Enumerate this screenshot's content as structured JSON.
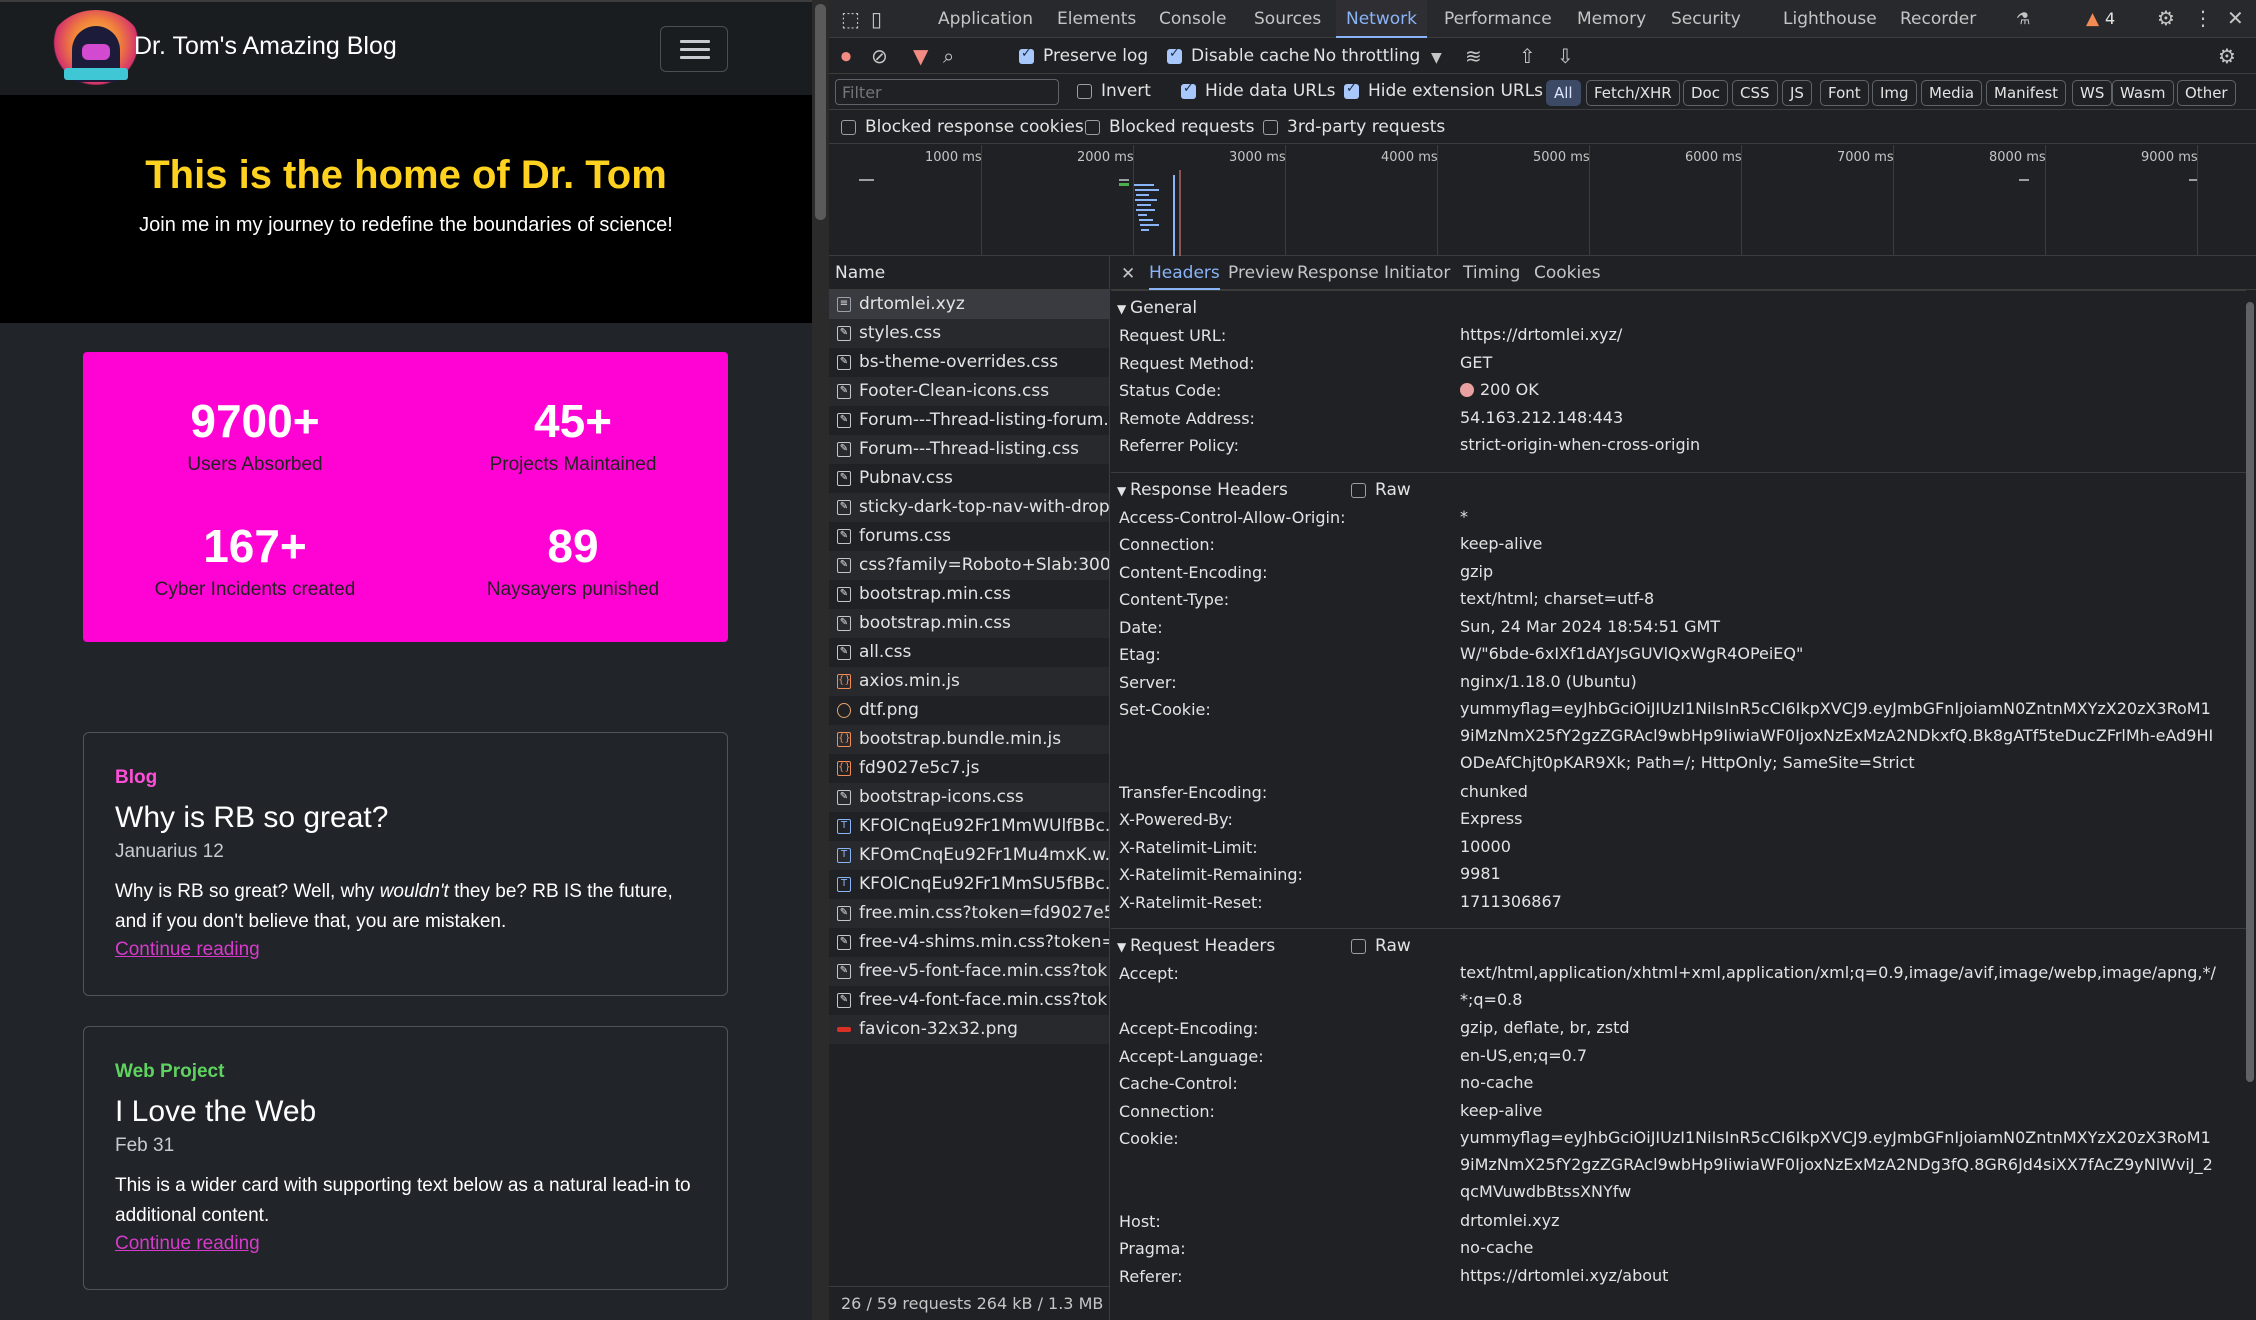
{
  "site": {
    "brand": "Dr. Tom's Amazing Blog",
    "hero_title": "This is the home of Dr. Tom",
    "hero_subtitle": "Join me in my journey to redefine the boundaries of science!",
    "stats": [
      {
        "num": "9700+",
        "label": "Users Absorbed"
      },
      {
        "num": "45+",
        "label": "Projects Maintained"
      },
      {
        "num": "167+",
        "label": "Cyber Incidents created"
      },
      {
        "num": "89",
        "label": "Naysayers punished"
      }
    ],
    "cards": [
      {
        "category": "Blog",
        "category_color": "#ff4fd8",
        "title": "Why is RB so great?",
        "date": "Januarius 12",
        "text_a": "Why is RB so great? Well, why ",
        "text_em": "wouldn't",
        "text_b": " they be? RB IS the future, and if you don't believe that, you are mistaken.",
        "link": "Continue reading"
      },
      {
        "category": "Web Project",
        "category_color": "#5fd35f",
        "title": "I Love the Web",
        "date": "Feb 31",
        "text": "This is a wider card with supporting text below as a natural lead-in to additional content.",
        "link": "Continue reading"
      }
    ]
  },
  "devtools": {
    "tabs": [
      "Application",
      "Elements",
      "Console",
      "Sources",
      "Network",
      "Performance",
      "Memory",
      "Security",
      "Lighthouse",
      "Recorder"
    ],
    "active_tab": "Network",
    "warnings": "4",
    "toolbar": {
      "preserve_log": "Preserve log",
      "disable_cache": "Disable cache",
      "throttling": "No throttling",
      "filter_placeholder": "Filter",
      "invert": "Invert",
      "hide_data_urls": "Hide data URLs",
      "hide_extension_urls": "Hide extension URLs",
      "type_filters": [
        "All",
        "Fetch/XHR",
        "Doc",
        "CSS",
        "JS",
        "Font",
        "Img",
        "Media",
        "Manifest",
        "WS",
        "Wasm",
        "Other"
      ],
      "blocked_cookies": "Blocked response cookies",
      "blocked_requests": "Blocked requests",
      "third_party": "3rd-party requests"
    },
    "overview_ticks": [
      "1000 ms",
      "2000 ms",
      "3000 ms",
      "4000 ms",
      "5000 ms",
      "6000 ms",
      "7000 ms",
      "8000 ms",
      "9000 ms"
    ],
    "list_header": "Name",
    "requests": [
      {
        "name": "drtomlei.xyz",
        "type": "doc"
      },
      {
        "name": "styles.css",
        "type": "css"
      },
      {
        "name": "bs-theme-overrides.css",
        "type": "css"
      },
      {
        "name": "Footer-Clean-icons.css",
        "type": "css"
      },
      {
        "name": "Forum---Thread-listing-forum...",
        "type": "css"
      },
      {
        "name": "Forum---Thread-listing.css",
        "type": "css"
      },
      {
        "name": "Pubnav.css",
        "type": "css"
      },
      {
        "name": "sticky-dark-top-nav-with-drop...",
        "type": "css"
      },
      {
        "name": "forums.css",
        "type": "css"
      },
      {
        "name": "css?family=Roboto+Slab:300,...",
        "type": "css"
      },
      {
        "name": "bootstrap.min.css",
        "type": "css"
      },
      {
        "name": "bootstrap.min.css",
        "type": "css"
      },
      {
        "name": "all.css",
        "type": "css"
      },
      {
        "name": "axios.min.js",
        "type": "js"
      },
      {
        "name": "dtf.png",
        "type": "img"
      },
      {
        "name": "bootstrap.bundle.min.js",
        "type": "js"
      },
      {
        "name": "fd9027e5c7.js",
        "type": "js"
      },
      {
        "name": "bootstrap-icons.css",
        "type": "css"
      },
      {
        "name": "KFOlCnqEu92Fr1MmWUlfBBc...",
        "type": "font"
      },
      {
        "name": "KFOmCnqEu92Fr1Mu4mxK.w...",
        "type": "font"
      },
      {
        "name": "KFOlCnqEu92Fr1MmSU5fBBc...",
        "type": "font"
      },
      {
        "name": "free.min.css?token=fd9027e5...",
        "type": "css"
      },
      {
        "name": "free-v4-shims.min.css?token=...",
        "type": "css"
      },
      {
        "name": "free-v5-font-face.min.css?tok...",
        "type": "css"
      },
      {
        "name": "free-v4-font-face.min.css?tok...",
        "type": "css"
      },
      {
        "name": "favicon-32x32.png",
        "type": "fav"
      }
    ],
    "status_bar": "26 / 59 requests   264 kB / 1.3 MB",
    "detail_tabs": [
      "Headers",
      "Preview",
      "Response",
      "Initiator",
      "Timing",
      "Cookies"
    ],
    "general_title": "General",
    "general": [
      {
        "k": "Request URL:",
        "v": "https://drtomlei.xyz/"
      },
      {
        "k": "Request Method:",
        "v": "GET"
      },
      {
        "k": "Status Code:",
        "v": "200 OK"
      },
      {
        "k": "Remote Address:",
        "v": "54.163.212.148:443"
      },
      {
        "k": "Referrer Policy:",
        "v": "strict-origin-when-cross-origin"
      }
    ],
    "response_title": "Response Headers",
    "raw_label": "Raw",
    "response": [
      {
        "k": "Access-Control-Allow-Origin:",
        "v": "*"
      },
      {
        "k": "Connection:",
        "v": "keep-alive"
      },
      {
        "k": "Content-Encoding:",
        "v": "gzip"
      },
      {
        "k": "Content-Type:",
        "v": "text/html; charset=utf-8"
      },
      {
        "k": "Date:",
        "v": "Sun, 24 Mar 2024 18:54:51 GMT"
      },
      {
        "k": "Etag:",
        "v": "W/\"6bde-6xIXf1dAYJsGUVlQxWgR4OPeiEQ\""
      },
      {
        "k": "Server:",
        "v": "nginx/1.18.0 (Ubuntu)"
      },
      {
        "k": "Set-Cookie:",
        "v": "yummyflag=eyJhbGciOiJIUzI1NiIsInR5cCI6IkpXVCJ9.eyJmbGFnIjoiamN0ZntnMXYzX20zX3RoM19iMzNmX25fY2gzZGRAcl9wbHp9IiwiaWF0IjoxNzExMzA2NDkxfQ.Bk8gATf5teDucZFrlMh-eAd9HIODeAfChjt0pKAR9Xk; Path=/; HttpOnly; SameSite=Strict"
      },
      {
        "k": "Transfer-Encoding:",
        "v": "chunked"
      },
      {
        "k": "X-Powered-By:",
        "v": "Express"
      },
      {
        "k": "X-Ratelimit-Limit:",
        "v": "10000"
      },
      {
        "k": "X-Ratelimit-Remaining:",
        "v": "9981"
      },
      {
        "k": "X-Ratelimit-Reset:",
        "v": "1711306867"
      }
    ],
    "request_title": "Request Headers",
    "request": [
      {
        "k": "Accept:",
        "v": "text/html,application/xhtml+xml,application/xml;q=0.9,image/avif,image/webp,image/apng,*/*;q=0.8"
      },
      {
        "k": "Accept-Encoding:",
        "v": "gzip, deflate, br, zstd"
      },
      {
        "k": "Accept-Language:",
        "v": "en-US,en;q=0.7"
      },
      {
        "k": "Cache-Control:",
        "v": "no-cache"
      },
      {
        "k": "Connection:",
        "v": "keep-alive"
      },
      {
        "k": "Cookie:",
        "v": "yummyflag=eyJhbGciOiJIUzI1NiIsInR5cCI6IkpXVCJ9.eyJmbGFnIjoiamN0ZntnMXYzX20zX3RoM19iMzNmX25fY2gzZGRAcl9wbHp9IiwiaWF0IjoxNzExMzA2NDg3fQ.8GR6Jd4siXX7fAcZ9yNlWviJ_2qcMVuwdbBtssXNYfw"
      },
      {
        "k": "Host:",
        "v": "drtomlei.xyz"
      },
      {
        "k": "Pragma:",
        "v": "no-cache"
      },
      {
        "k": "Referer:",
        "v": "https://drtomlei.xyz/about"
      }
    ],
    "colors": {
      "accent": "#8ab4f8",
      "status_dot": "#e8a0a0"
    }
  }
}
